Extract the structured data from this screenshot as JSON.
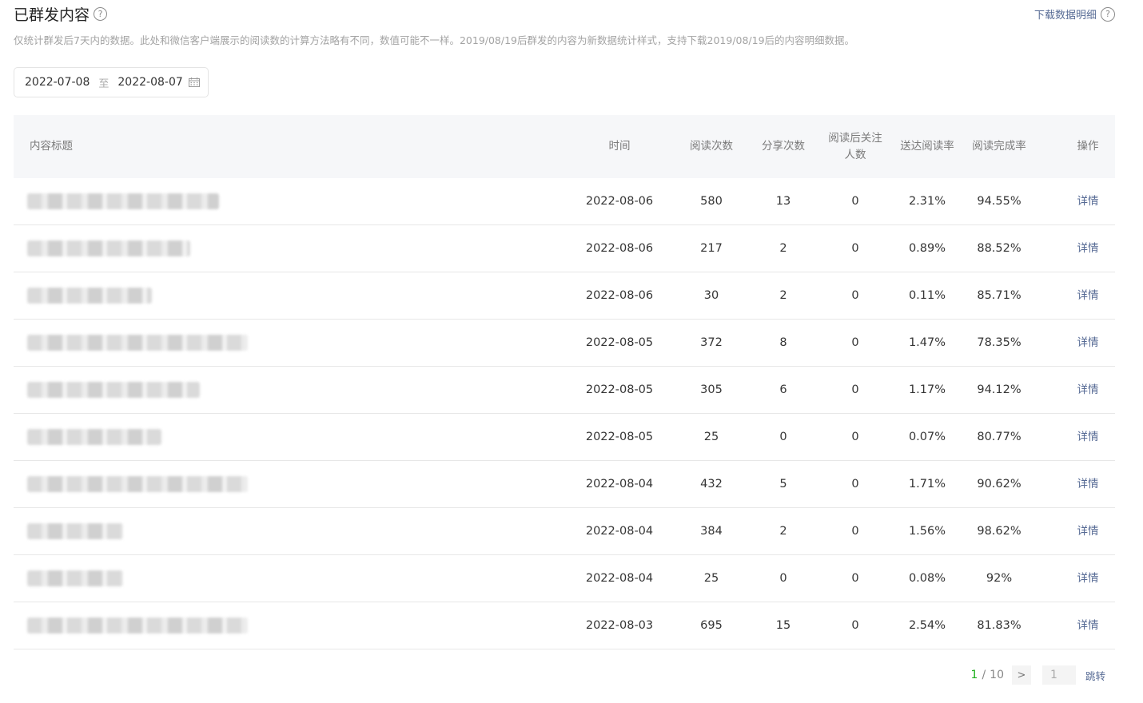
{
  "header": {
    "title": "已群发内容",
    "help_icon": "question-circle-icon",
    "download_label": "下载数据明细",
    "description": "仅统计群发后7天内的数据。此处和微信客户端展示的阅读数的计算方法略有不同，数值可能不一样。2019/08/19后群发的内容为新数据统计样式，支持下载2019/08/19后的内容明细数据。"
  },
  "date_range": {
    "start": "2022-07-08",
    "separator": "至",
    "end": "2022-08-07",
    "icon": "calendar-icon"
  },
  "table": {
    "columns": [
      "内容标题",
      "时间",
      "阅读次数",
      "分享次数",
      "阅读后关注人数",
      "送达阅读率",
      "阅读完成率",
      "操作"
    ],
    "rows": [
      {
        "time": "2022-08-06",
        "reads": "580",
        "shares": "13",
        "follows": "0",
        "rate": "2.31%",
        "completion": "94.55%",
        "action": "详情"
      },
      {
        "time": "2022-08-06",
        "reads": "217",
        "shares": "2",
        "follows": "0",
        "rate": "0.89%",
        "completion": "88.52%",
        "action": "详情"
      },
      {
        "time": "2022-08-06",
        "reads": "30",
        "shares": "2",
        "follows": "0",
        "rate": "0.11%",
        "completion": "85.71%",
        "action": "详情"
      },
      {
        "time": "2022-08-05",
        "reads": "372",
        "shares": "8",
        "follows": "0",
        "rate": "1.47%",
        "completion": "78.35%",
        "action": "详情"
      },
      {
        "time": "2022-08-05",
        "reads": "305",
        "shares": "6",
        "follows": "0",
        "rate": "1.17%",
        "completion": "94.12%",
        "action": "详情"
      },
      {
        "time": "2022-08-05",
        "reads": "25",
        "shares": "0",
        "follows": "0",
        "rate": "0.07%",
        "completion": "80.77%",
        "action": "详情"
      },
      {
        "time": "2022-08-04",
        "reads": "432",
        "shares": "5",
        "follows": "0",
        "rate": "1.71%",
        "completion": "90.62%",
        "action": "详情"
      },
      {
        "time": "2022-08-04",
        "reads": "384",
        "shares": "2",
        "follows": "0",
        "rate": "1.56%",
        "completion": "98.62%",
        "action": "详情"
      },
      {
        "time": "2022-08-04",
        "reads": "25",
        "shares": "0",
        "follows": "0",
        "rate": "0.08%",
        "completion": "92%",
        "action": "详情"
      },
      {
        "time": "2022-08-03",
        "reads": "695",
        "shares": "15",
        "follows": "0",
        "rate": "2.54%",
        "completion": "81.83%",
        "action": "详情"
      }
    ]
  },
  "pagination": {
    "current": "1",
    "separator": "/",
    "total": "10",
    "next_icon": "chevron-right-icon",
    "input_value": "1",
    "jump_label": "跳转"
  },
  "colors": {
    "link": "#576b95",
    "current_page": "#1aad19",
    "header_bg": "#f6f7f9"
  }
}
